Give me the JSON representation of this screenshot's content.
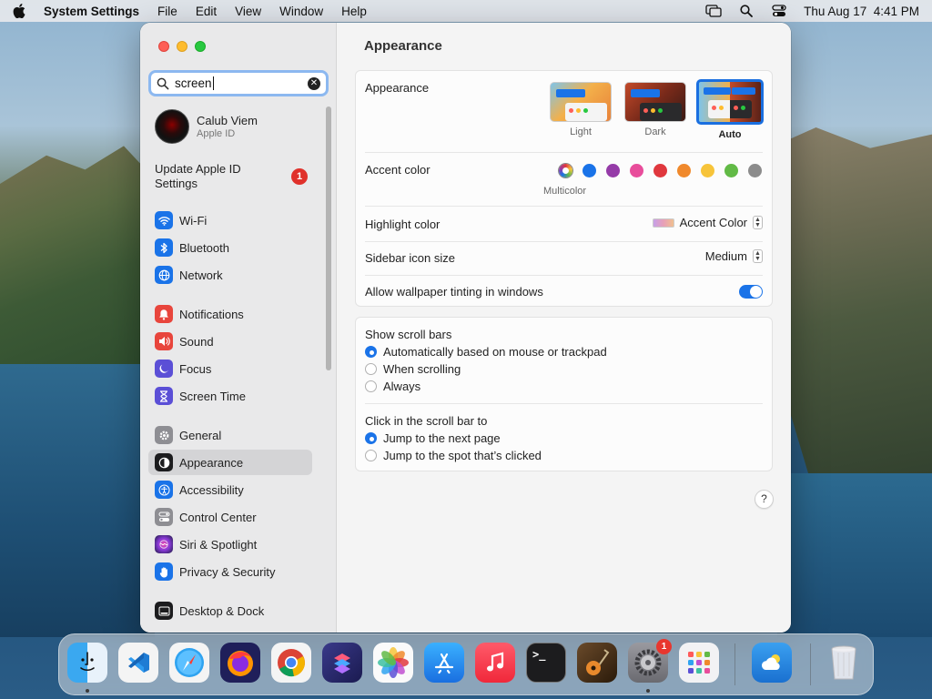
{
  "menubar": {
    "app_name": "System Settings",
    "menus": [
      "File",
      "Edit",
      "View",
      "Window",
      "Help"
    ],
    "datetime": "Thu Aug 17  4:41 PM"
  },
  "sidebar": {
    "search": {
      "value": "screen"
    },
    "profile": {
      "name": "Calub Viem",
      "subtitle": "Apple ID"
    },
    "update": {
      "label": "Update Apple ID Settings",
      "badge": "1"
    },
    "items": [
      {
        "label": "Wi-Fi",
        "icon": "wifi-icon",
        "color": "#1a73e8"
      },
      {
        "label": "Bluetooth",
        "icon": "bluetooth-icon",
        "color": "#1a73e8"
      },
      {
        "label": "Network",
        "icon": "globe-icon",
        "color": "#1a73e8"
      },
      {
        "label": "Notifications",
        "icon": "bell-icon",
        "color": "#e8453c"
      },
      {
        "label": "Sound",
        "icon": "speaker-icon",
        "color": "#e8453c"
      },
      {
        "label": "Focus",
        "icon": "moon-icon",
        "color": "#5b4fd6"
      },
      {
        "label": "Screen Time",
        "icon": "hourglass-icon",
        "color": "#5b4fd6"
      },
      {
        "label": "General",
        "icon": "gear-icon",
        "color": "#8e8e93"
      },
      {
        "label": "Appearance",
        "icon": "appearance-icon",
        "color": "#1c1c1e"
      },
      {
        "label": "Accessibility",
        "icon": "accessibility-icon",
        "color": "#1a73e8"
      },
      {
        "label": "Control Center",
        "icon": "control-center-icon",
        "color": "#8e8e93"
      },
      {
        "label": "Siri & Spotlight",
        "icon": "siri-icon",
        "color": "#c04fd0"
      },
      {
        "label": "Privacy & Security",
        "icon": "hand-icon",
        "color": "#1a73e8"
      },
      {
        "label": "Desktop & Dock",
        "icon": "dock-icon",
        "color": "#1c1c1e"
      }
    ],
    "selected": "Appearance"
  },
  "main": {
    "title": "Appearance",
    "appearance": {
      "label": "Appearance",
      "options": [
        {
          "label": "Light",
          "selected": false
        },
        {
          "label": "Dark",
          "selected": false
        },
        {
          "label": "Auto",
          "selected": true
        }
      ]
    },
    "accent": {
      "label": "Accent color",
      "selected_label": "Multicolor",
      "colors": [
        "multicolor",
        "#1a73e8",
        "#953ba8",
        "#e84d9b",
        "#e0383e",
        "#f0892c",
        "#f7c43a",
        "#62ba46",
        "#8c8c8c"
      ]
    },
    "highlight": {
      "label": "Highlight color",
      "value": "Accent Color"
    },
    "sidebar_icon_size": {
      "label": "Sidebar icon size",
      "value": "Medium"
    },
    "wallpaper_tinting": {
      "label": "Allow wallpaper tinting in windows",
      "enabled": true
    },
    "scroll_bars": {
      "label": "Show scroll bars",
      "options": [
        {
          "label": "Automatically based on mouse or trackpad",
          "selected": true
        },
        {
          "label": "When scrolling",
          "selected": false
        },
        {
          "label": "Always",
          "selected": false
        }
      ]
    },
    "click_scroll": {
      "label": "Click in the scroll bar to",
      "options": [
        {
          "label": "Jump to the next page",
          "selected": true
        },
        {
          "label": "Jump to the spot that’s clicked",
          "selected": false
        }
      ]
    },
    "help": "?"
  },
  "dock": {
    "apps": [
      "Finder",
      "Visual Studio Code",
      "Safari",
      "Firefox",
      "Chrome",
      "Shortcuts",
      "Photos",
      "App Store",
      "Music",
      "Terminal",
      "GarageBand",
      "System Settings",
      "Launchpad",
      "Weather",
      "Trash"
    ],
    "settings_badge": "1"
  }
}
